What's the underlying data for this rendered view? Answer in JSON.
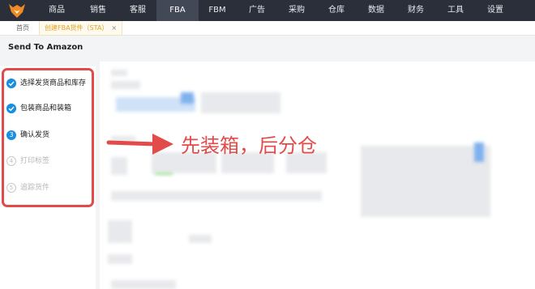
{
  "nav": {
    "items": [
      "商品",
      "销售",
      "客服",
      "FBA",
      "FBM",
      "广告",
      "采购",
      "仓库",
      "数据",
      "财务",
      "工具",
      "设置"
    ],
    "active": "FBA"
  },
  "tabs": {
    "home": "首页",
    "current": "创建FBA货件（STA）",
    "close": "×"
  },
  "page": {
    "title": "Send To Amazon"
  },
  "steps": [
    {
      "label": "选择发货商品和库存",
      "state": "done"
    },
    {
      "label": "包装商品和装箱",
      "state": "done"
    },
    {
      "number": "3",
      "label": "确认发货",
      "state": "current"
    },
    {
      "number": "4",
      "label": "打印标签",
      "state": "todo"
    },
    {
      "number": "5",
      "label": "追踪货件",
      "state": "todo"
    }
  ],
  "annotation": {
    "text": "先装箱，后分仓"
  },
  "colors": {
    "accent": "#1a8fe0",
    "highlight": "#e34a4a",
    "nav_bg": "#2b2f3a",
    "tab_active": "#e2a31f"
  }
}
